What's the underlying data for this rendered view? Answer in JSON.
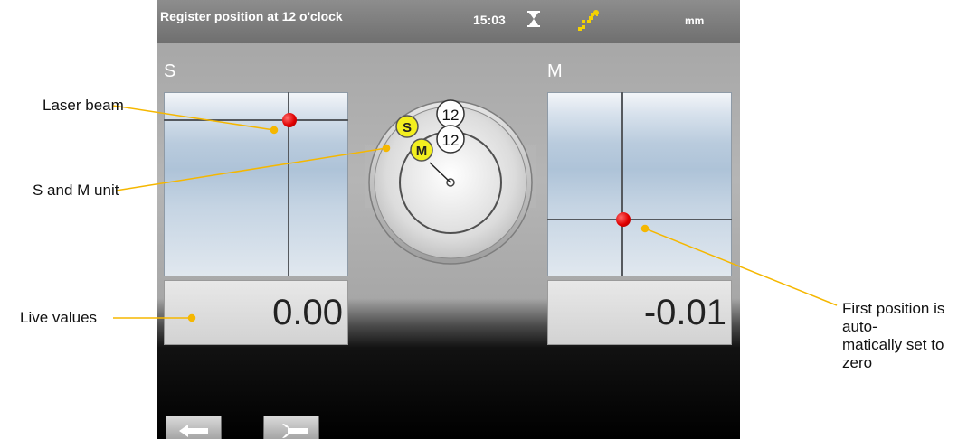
{
  "titlebar": {
    "title": "Register position at 12 o'clock",
    "time": "15:03",
    "unit": "mm",
    "icons": [
      "hourglass-icon",
      "sensor-status-icon"
    ]
  },
  "panels": {
    "s": {
      "label": "S",
      "value": "0.00"
    },
    "m": {
      "label": "M",
      "value": "-0.01"
    }
  },
  "dial": {
    "outer_marker": "12",
    "inner_marker": "12",
    "s_badge": "S",
    "m_badge": "M"
  },
  "buttons": {
    "back": "back-arrow-icon",
    "tools": "wrench-icon"
  },
  "annotations": {
    "laser_beam": "Laser beam",
    "s_and_m_unit": "S and M unit",
    "live_values": "Live values",
    "first_position_line1": "First position is auto-",
    "first_position_line2": "matically set to zero"
  },
  "colors": {
    "callout_line": "#f5b700",
    "laser_dot": "#e00000",
    "badge_yellow": "#f3ef1f"
  }
}
